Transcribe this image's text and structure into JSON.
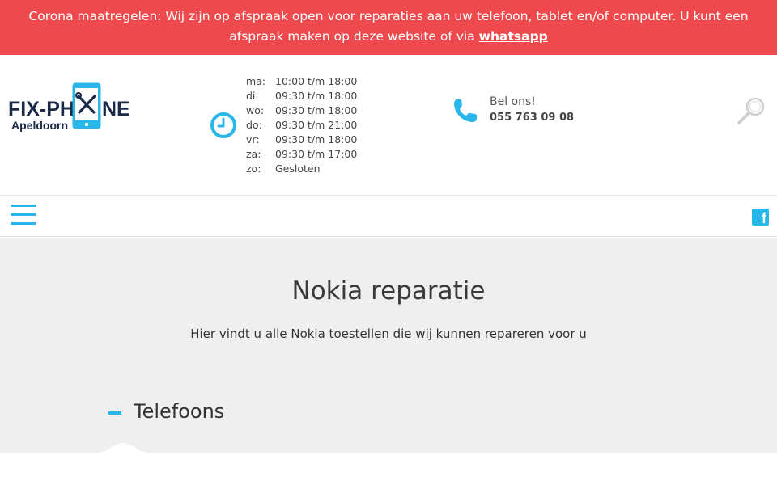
{
  "banner": {
    "text": "Corona maatregelen: Wij zijn op afspraak open voor reparaties aan uw telefoon, tablet en/of computer. U kunt een afspraak maken op deze website of via ",
    "link_label": "whatsapp"
  },
  "logo": {
    "word_left": "FIX-PH",
    "word_right": "NE",
    "subtitle": "Apeldoorn"
  },
  "hours": [
    {
      "day": "ma:",
      "time": "10:00 t/m 18:00"
    },
    {
      "day": "di:",
      "time": "09:30 t/m 18:00"
    },
    {
      "day": "wo:",
      "time": "09:30 t/m 18:00"
    },
    {
      "day": "do:",
      "time": "09:30 t/m 21:00"
    },
    {
      "day": "vr:",
      "time": "09:30 t/m 18:00"
    },
    {
      "day": "za:",
      "time": "09:30 t/m 17:00"
    },
    {
      "day": "zo:",
      "time": "Gesloten"
    }
  ],
  "contact": {
    "label": "Bel ons!",
    "phone": "055 763 09 08"
  },
  "main": {
    "title": "Nokia reparatie",
    "subtitle": "Hier vindt u alle Nokia toestellen die wij kunnen repareren voor u",
    "section_label": "Telefoons"
  },
  "icons": {
    "clock": "clock-icon",
    "phone": "phone-icon",
    "search": "search-icon",
    "menu": "hamburger-menu-icon",
    "facebook": "facebook-icon"
  },
  "colors": {
    "banner": "#ee4a4d",
    "accent": "#29b6e8",
    "logo_text": "#1b2a4a",
    "main_bg": "#efefef"
  }
}
